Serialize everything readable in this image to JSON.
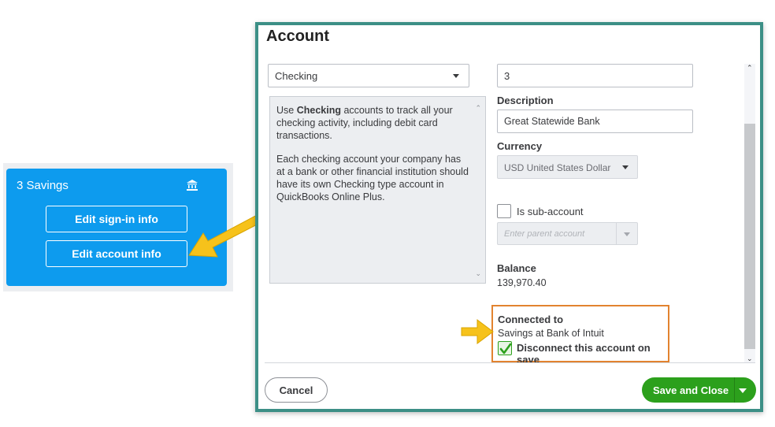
{
  "card": {
    "title": "3 Savings",
    "icon": "bank-icon",
    "buttons": [
      "Edit sign-in info",
      "Edit account info"
    ]
  },
  "dialog": {
    "title": "Account",
    "account_type": "Checking",
    "type_description": [
      {
        "pre": "Use ",
        "bold": "Checking",
        "post": " accounts to track all your checking activity, including debit card transactions."
      },
      {
        "pre": "Each checking account your company has at a bank or other financial institution should have its own Checking type account in QuickBooks Online Plus.",
        "bold": "",
        "post": ""
      }
    ],
    "account_number": "3",
    "description_label": "Description",
    "description_value": "Great Statewide Bank",
    "currency_label": "Currency",
    "currency_value": "USD United States Dollar",
    "subaccount_label": "Is sub-account",
    "subaccount_checked": false,
    "parent_placeholder": "Enter parent account",
    "balance_label": "Balance",
    "balance_value": "139,970.40",
    "connected_label": "Connected to",
    "connected_value": "Savings at Bank of Intuit",
    "disconnect_label": "Disconnect this account on save",
    "disconnect_checked": true,
    "cancel_label": "Cancel",
    "save_label": "Save and Close"
  },
  "colors": {
    "card_bg": "#0d9bee",
    "dialog_border": "#3c8f86",
    "highlight_border": "#e2832f",
    "arrow": "#f6c21b",
    "primary_button": "#2ca01c"
  }
}
